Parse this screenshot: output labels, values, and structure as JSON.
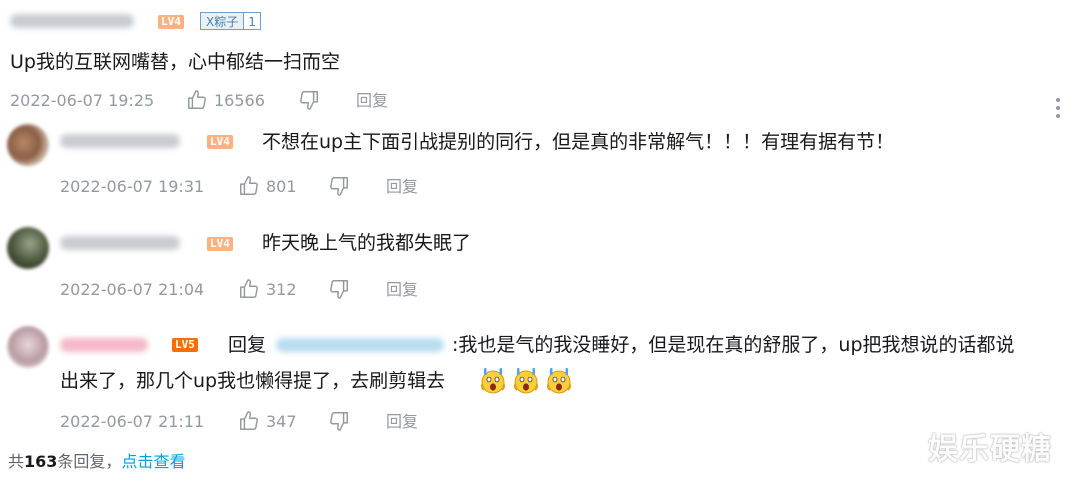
{
  "comment": {
    "level_badge": "LV4",
    "medal_name": "X粽子",
    "medal_level": "1",
    "text": "Up我的互联网嘴替，心中郁结一扫而空",
    "time": "2022-06-07 19:25",
    "likes": "16566",
    "reply_label": "回复"
  },
  "replies": [
    {
      "level_badge": "LV4",
      "text": "不想在up主下面引战提别的同行，但是真的非常解气！！！有理有据有节！",
      "time": "2022-06-07 19:31",
      "likes": "801",
      "reply_label": "回复"
    },
    {
      "level_badge": "LV4",
      "text": "昨天晚上气的我都失眠了",
      "time": "2022-06-07 21:04",
      "likes": "312",
      "reply_label": "回复"
    },
    {
      "level_badge": "LV5",
      "prefix": "回复",
      "text_line1": ":我也是气的我没睡好，但是现在真的舒服了，up把我想说的话都说",
      "text_line2": "出来了，那几个up我也懒得提了，去刷剪辑去",
      "emojis": [
        "scream-emoji",
        "scream-emoji",
        "scream-emoji"
      ],
      "time": "2022-06-07 21:11",
      "likes": "347",
      "reply_label": "回复"
    }
  ],
  "footer": {
    "prefix": "共",
    "count": "163",
    "suffix": "条回复，",
    "link": "点击查看"
  },
  "watermark": "娱乐硬糖",
  "colors": {
    "meta_gray": "#9499a0",
    "link_blue": "#00a1d6",
    "lv4": "#ffb27f",
    "lv5": "#ff6c00"
  }
}
